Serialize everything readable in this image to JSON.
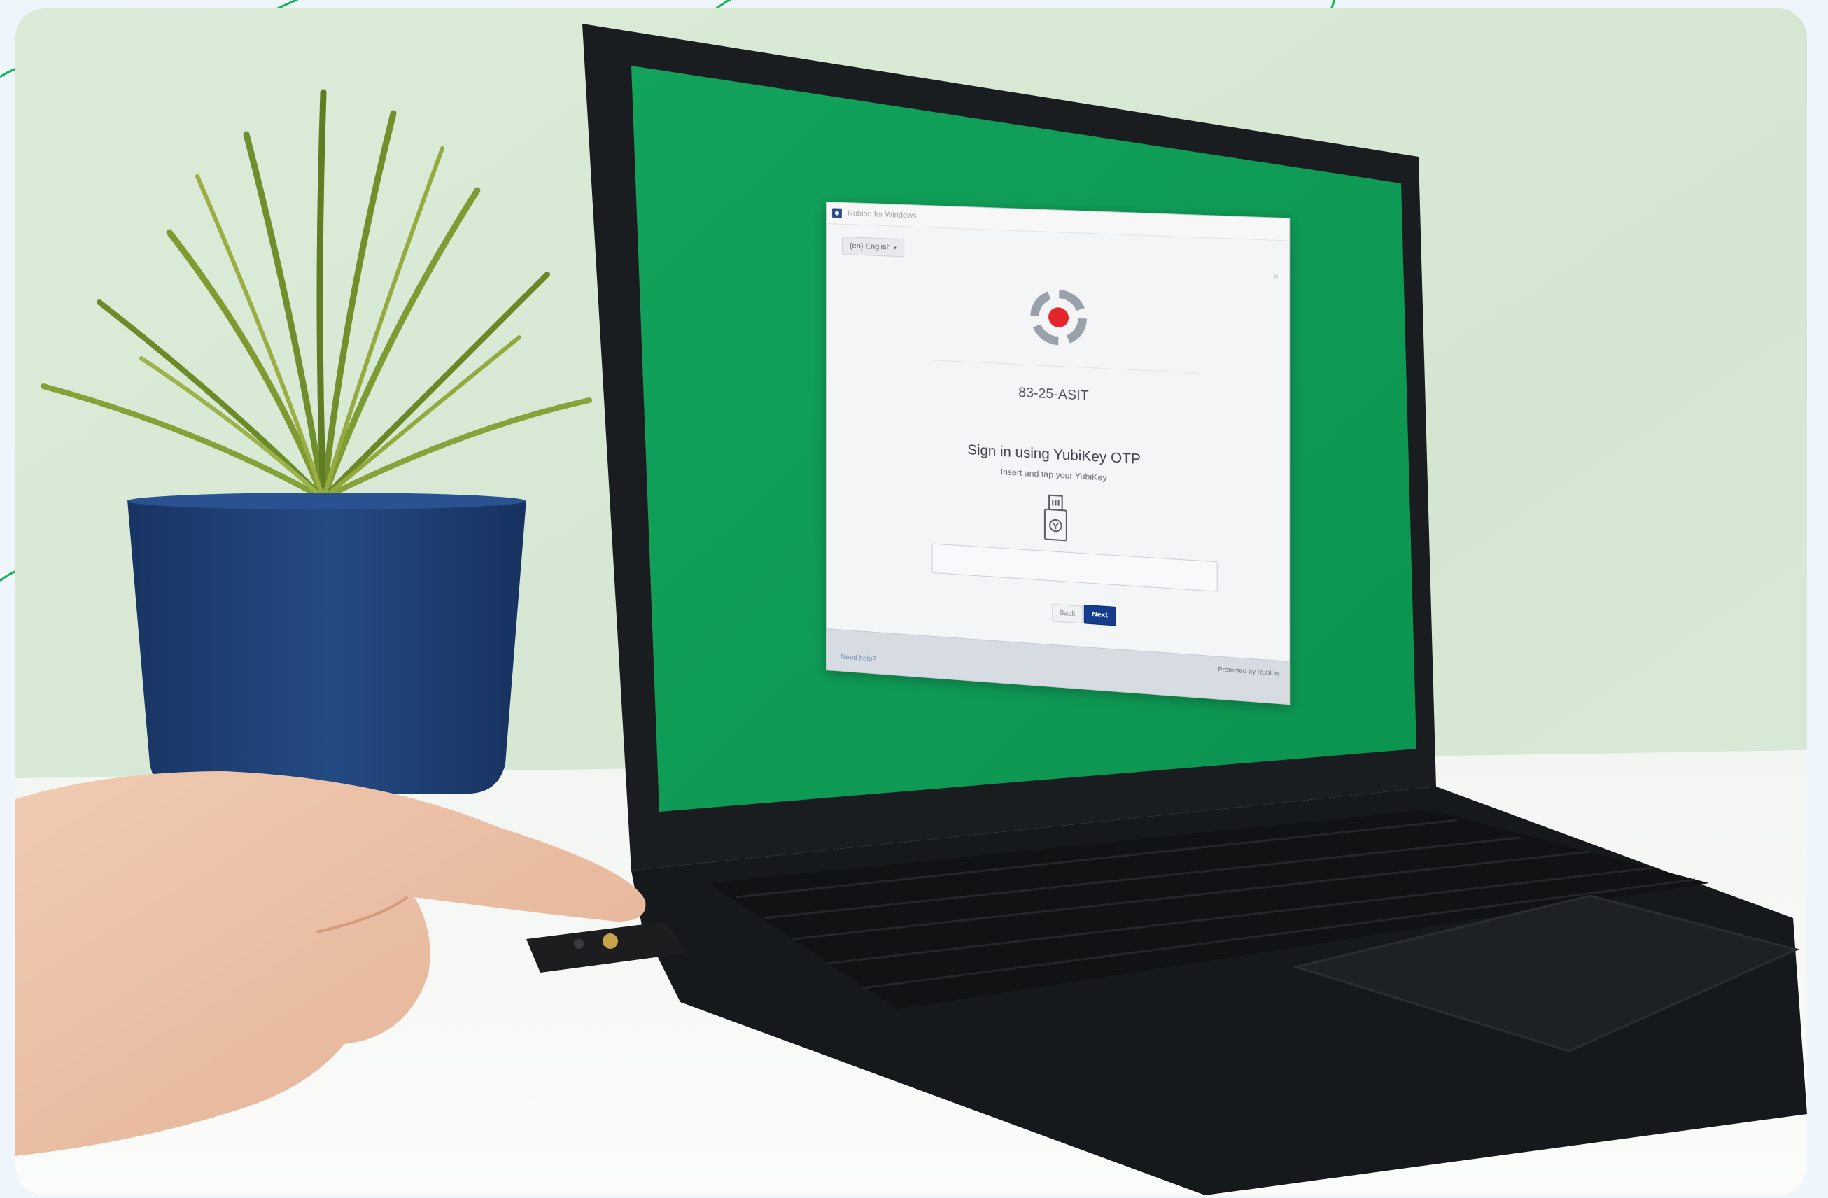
{
  "dialog": {
    "window_title": "Rublon for Windows",
    "language": "(en) English",
    "language_caret": "▾",
    "close": "×",
    "machine_name": "83-25-ASIT",
    "heading": "Sign in using YubiKey OTP",
    "subheading": "Insert and tap your YubiKey",
    "otp_value": "",
    "back_label": "Back",
    "next_label": "Next",
    "need_help": "Need help?",
    "protected_by": "Protected by Rublon"
  },
  "colors": {
    "screen_green": "#0fa05a",
    "laptop_body": "#15181a",
    "pot": "#1f3e72",
    "brand_red": "#e3262b",
    "next_button": "#143c8c",
    "accent_lines": "#17b455"
  },
  "icons": [
    "rublon-logo-icon",
    "yubikey-icon",
    "app-icon",
    "close-icon",
    "chevron-down-icon"
  ]
}
